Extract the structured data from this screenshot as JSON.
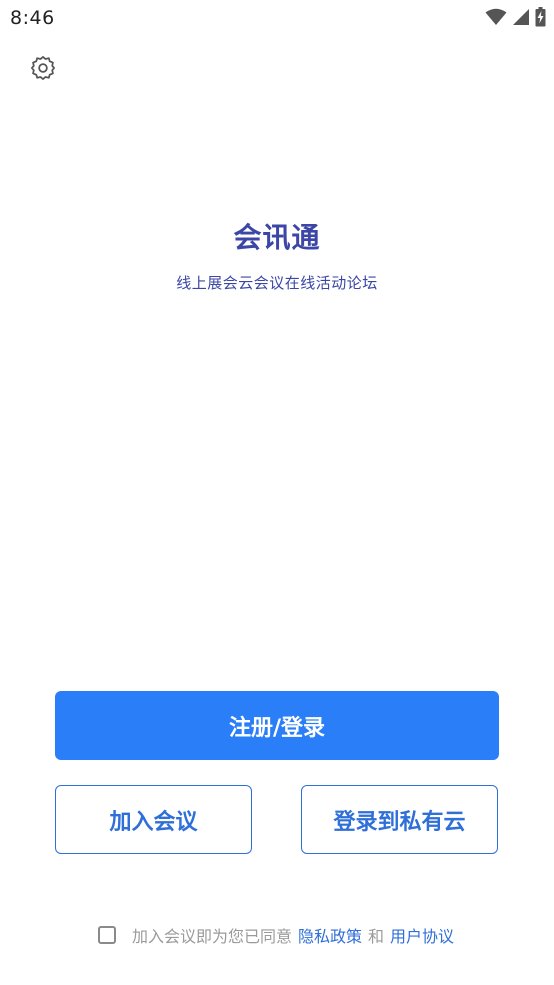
{
  "status_bar": {
    "time": "8:46",
    "icons": [
      "wifi-icon",
      "cellular-signal-icon",
      "battery-charging-icon"
    ]
  },
  "toolbar": {
    "settings_icon": "gear-icon"
  },
  "app": {
    "title": "会讯通",
    "subtitle": "线上展会云会议在线活动论坛"
  },
  "actions": {
    "register_login_label": "注册/登录",
    "join_meeting_label": "加入会议",
    "private_cloud_label": "登录到私有云"
  },
  "agreement": {
    "checked": false,
    "prefix": "加入会议即为您已同意",
    "privacy_link": "隐私政策",
    "and_text": "和",
    "terms_link": "用户协议"
  },
  "colors": {
    "primary": "#2a7ef8",
    "outline": "#2f6fd8",
    "title": "#3b46a6",
    "muted_text": "#9a9a9a"
  }
}
